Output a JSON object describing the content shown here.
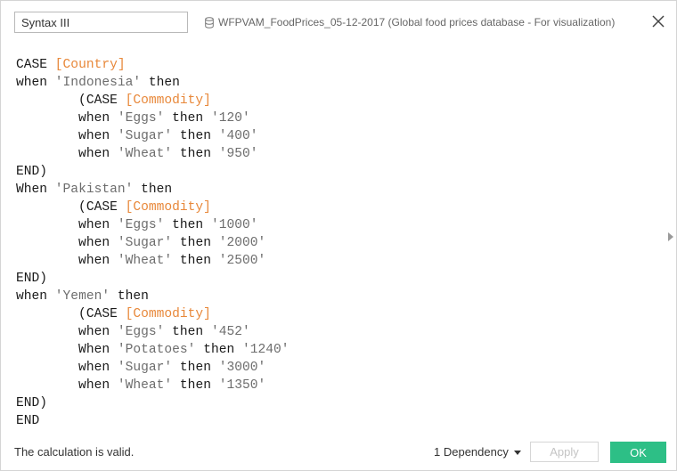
{
  "calc_name": "Syntax III",
  "datasource": "WFPVAM_FoodPrices_05-12-2017 (Global food prices database - For visualization)",
  "code_lines": [
    [
      {
        "t": "kw",
        "v": "CASE "
      },
      {
        "t": "fld",
        "v": "[Country]"
      }
    ],
    [
      {
        "t": "kw",
        "v": "when "
      },
      {
        "t": "str",
        "v": "'Indonesia'"
      },
      {
        "t": "kw",
        "v": " then"
      }
    ],
    [
      {
        "t": "kw",
        "v": "        (CASE "
      },
      {
        "t": "fld",
        "v": "[Commodity]"
      }
    ],
    [
      {
        "t": "kw",
        "v": "        when "
      },
      {
        "t": "str",
        "v": "'Eggs'"
      },
      {
        "t": "kw",
        "v": " then "
      },
      {
        "t": "str",
        "v": "'120'"
      }
    ],
    [
      {
        "t": "kw",
        "v": "        when "
      },
      {
        "t": "str",
        "v": "'Sugar'"
      },
      {
        "t": "kw",
        "v": " then "
      },
      {
        "t": "str",
        "v": "'400'"
      }
    ],
    [
      {
        "t": "kw",
        "v": "        when "
      },
      {
        "t": "str",
        "v": "'Wheat'"
      },
      {
        "t": "kw",
        "v": " then "
      },
      {
        "t": "str",
        "v": "'950'"
      }
    ],
    [
      {
        "t": "kw",
        "v": "END)"
      }
    ],
    [
      {
        "t": "kw",
        "v": "When "
      },
      {
        "t": "str",
        "v": "'Pakistan'"
      },
      {
        "t": "kw",
        "v": " then"
      }
    ],
    [
      {
        "t": "kw",
        "v": "        (CASE "
      },
      {
        "t": "fld",
        "v": "[Commodity]"
      }
    ],
    [
      {
        "t": "kw",
        "v": "        when "
      },
      {
        "t": "str",
        "v": "'Eggs'"
      },
      {
        "t": "kw",
        "v": " then "
      },
      {
        "t": "str",
        "v": "'1000'"
      }
    ],
    [
      {
        "t": "kw",
        "v": "        when "
      },
      {
        "t": "str",
        "v": "'Sugar'"
      },
      {
        "t": "kw",
        "v": " then "
      },
      {
        "t": "str",
        "v": "'2000'"
      }
    ],
    [
      {
        "t": "kw",
        "v": "        when "
      },
      {
        "t": "str",
        "v": "'Wheat'"
      },
      {
        "t": "kw",
        "v": " then "
      },
      {
        "t": "str",
        "v": "'2500'"
      }
    ],
    [
      {
        "t": "kw",
        "v": "END)"
      }
    ],
    [
      {
        "t": "kw",
        "v": "when "
      },
      {
        "t": "str",
        "v": "'Yemen'"
      },
      {
        "t": "kw",
        "v": " then"
      }
    ],
    [
      {
        "t": "kw",
        "v": "        (CASE "
      },
      {
        "t": "fld",
        "v": "[Commodity]"
      }
    ],
    [
      {
        "t": "kw",
        "v": "        when "
      },
      {
        "t": "str",
        "v": "'Eggs'"
      },
      {
        "t": "kw",
        "v": " then "
      },
      {
        "t": "str",
        "v": "'452'"
      }
    ],
    [
      {
        "t": "kw",
        "v": "        When "
      },
      {
        "t": "str",
        "v": "'Potatoes'"
      },
      {
        "t": "kw",
        "v": " then "
      },
      {
        "t": "str",
        "v": "'1240'"
      }
    ],
    [
      {
        "t": "kw",
        "v": "        when "
      },
      {
        "t": "str",
        "v": "'Sugar'"
      },
      {
        "t": "kw",
        "v": " then "
      },
      {
        "t": "str",
        "v": "'3000'"
      }
    ],
    [
      {
        "t": "kw",
        "v": "        when "
      },
      {
        "t": "str",
        "v": "'Wheat'"
      },
      {
        "t": "kw",
        "v": " then "
      },
      {
        "t": "str",
        "v": "'1350'"
      }
    ],
    [
      {
        "t": "kw",
        "v": "END)"
      }
    ],
    [
      {
        "t": "kw",
        "v": "END"
      }
    ]
  ],
  "status_text": "The calculation is valid.",
  "dependency_label": "1 Dependency",
  "apply_label": "Apply",
  "ok_label": "OK",
  "colors": {
    "field": "#e8883a",
    "string": "#6d6d6d",
    "ok": "#2dbf86"
  },
  "icons": {
    "datasource": "database-icon",
    "close": "close-icon",
    "dependency": "caret-down-icon",
    "expander": "chevron-right-icon"
  }
}
